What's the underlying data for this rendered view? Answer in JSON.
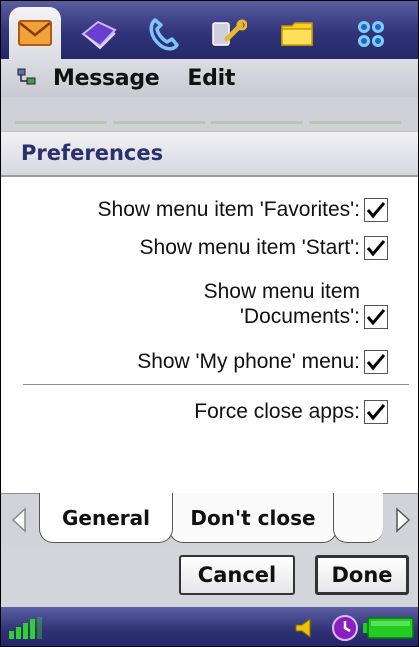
{
  "app_tabs": [
    {
      "icon": "envelope-icon",
      "active": true
    },
    {
      "icon": "contacts-book-icon",
      "active": false
    },
    {
      "icon": "phone-handset-icon",
      "active": false
    },
    {
      "icon": "tools-icon",
      "active": false
    },
    {
      "icon": "folder-icon",
      "active": false
    },
    {
      "icon": "apps-grid-icon",
      "active": false
    }
  ],
  "menubar": {
    "icon": "tree-menu-icon",
    "items": [
      "Message",
      "Edit"
    ]
  },
  "dialog": {
    "title": "Preferences"
  },
  "options": [
    {
      "label": "Show menu item 'Favorites':",
      "checked": true
    },
    {
      "label": "Show menu item 'Start':",
      "checked": true
    },
    {
      "label_line1": "Show menu item",
      "label_line2": "'Documents':",
      "checked": true
    },
    {
      "label": "Show 'My phone' menu:",
      "checked": true
    },
    {
      "label": "Force close apps:",
      "checked": true
    }
  ],
  "tabs": [
    {
      "label": "General",
      "active": true
    },
    {
      "label": "Don't close",
      "active": false
    }
  ],
  "buttons": {
    "cancel": "Cancel",
    "done": "Done"
  },
  "status_icons": [
    "signal-strength-icon",
    "speaker-icon",
    "clock-icon",
    "battery-icon"
  ],
  "colors": {
    "title_text": "#2a2f6e",
    "chrome_blue": "#32347a",
    "signal_green": "#2fd02f",
    "battery_green": "#22cc22",
    "clock_purple": "#8a1fbf",
    "speaker_yellow": "#f2c200"
  }
}
